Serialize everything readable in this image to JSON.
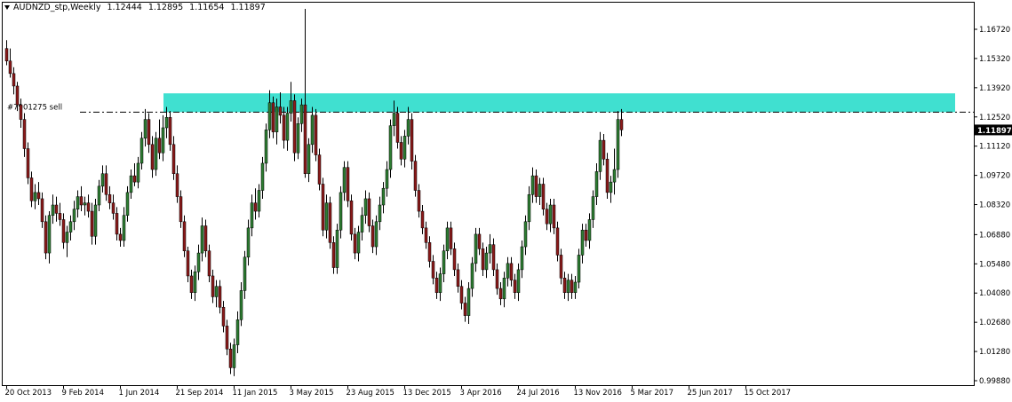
{
  "header": {
    "symbol": "AUDNZD_stp,Weekly",
    "open": "1.12444",
    "high": "1.12895",
    "low": "1.11654",
    "close": "1.11897"
  },
  "order_line": {
    "label": "#7901275 sell",
    "price": 1.1275
  },
  "zone": {
    "top": 1.1365,
    "bottom": 1.1275,
    "color": "#40E0D0"
  },
  "current_price": {
    "label": "1.11897",
    "value": 1.11897
  },
  "colors": {
    "bull": "#2E7D32",
    "bear": "#8B1A1A",
    "wick": "#000000",
    "grid": "#000000"
  },
  "chart_data": {
    "type": "candlestick",
    "ylim": [
      0.9988,
      1.1772
    ],
    "y_ticks": [
      "1.16720",
      "1.15320",
      "1.13920",
      "1.12520",
      "1.11120",
      "1.09720",
      "1.08320",
      "1.06880",
      "1.05480",
      "1.04080",
      "1.02680",
      "1.01280",
      "0.99880"
    ],
    "y_tick_values": [
      1.1672,
      1.1532,
      1.1392,
      1.1252,
      1.1112,
      1.0972,
      1.0832,
      1.0688,
      1.0548,
      1.0408,
      1.0268,
      1.0128,
      0.9988
    ],
    "x_ticks": [
      "20 Oct 2013",
      "9 Feb 2014",
      "1 Jun 2014",
      "21 Sep 2014",
      "11 Jan 2015",
      "3 May 2015",
      "23 Aug 2015",
      "13 Dec 2015",
      "3 Apr 2016",
      "24 Jul 2016",
      "13 Nov 2016",
      "5 Mar 2017",
      "25 Jun 2017",
      "15 Oct 2017"
    ],
    "x_tick_index": [
      0,
      16,
      32,
      48,
      64,
      80,
      96,
      112,
      128,
      144,
      160,
      176,
      192,
      208
    ],
    "candles": [
      [
        1.158,
        1.162,
        1.15,
        1.152
      ],
      [
        1.152,
        1.158,
        1.144,
        1.146
      ],
      [
        1.146,
        1.149,
        1.136,
        1.14
      ],
      [
        1.14,
        1.142,
        1.128,
        1.131
      ],
      [
        1.131,
        1.134,
        1.12,
        1.124
      ],
      [
        1.124,
        1.127,
        1.106,
        1.11
      ],
      [
        1.11,
        1.113,
        1.093,
        1.096
      ],
      [
        1.096,
        1.099,
        1.082,
        1.085
      ],
      [
        1.085,
        1.093,
        1.081,
        1.089
      ],
      [
        1.089,
        1.094,
        1.083,
        1.086
      ],
      [
        1.086,
        1.089,
        1.072,
        1.075
      ],
      [
        1.075,
        1.078,
        1.057,
        1.06
      ],
      [
        1.06,
        1.08,
        1.055,
        1.078
      ],
      [
        1.078,
        1.088,
        1.074,
        1.083
      ],
      [
        1.083,
        1.087,
        1.075,
        1.079
      ],
      [
        1.079,
        1.084,
        1.073,
        1.076
      ],
      [
        1.076,
        1.079,
        1.062,
        1.065
      ],
      [
        1.065,
        1.073,
        1.058,
        1.07
      ],
      [
        1.07,
        1.078,
        1.066,
        1.075
      ],
      [
        1.075,
        1.085,
        1.071,
        1.081
      ],
      [
        1.081,
        1.09,
        1.077,
        1.087
      ],
      [
        1.087,
        1.092,
        1.08,
        1.083
      ],
      [
        1.083,
        1.087,
        1.078,
        1.084
      ],
      [
        1.084,
        1.088,
        1.077,
        1.08
      ],
      [
        1.08,
        1.084,
        1.064,
        1.068
      ],
      [
        1.068,
        1.086,
        1.064,
        1.083
      ],
      [
        1.083,
        1.095,
        1.08,
        1.092
      ],
      [
        1.092,
        1.102,
        1.089,
        1.098
      ],
      [
        1.098,
        1.102,
        1.085,
        1.088
      ],
      [
        1.088,
        1.092,
        1.081,
        1.084
      ],
      [
        1.084,
        1.088,
        1.076,
        1.079
      ],
      [
        1.079,
        1.082,
        1.066,
        1.069
      ],
      [
        1.069,
        1.072,
        1.063,
        1.066
      ],
      [
        1.066,
        1.082,
        1.063,
        1.078
      ],
      [
        1.078,
        1.092,
        1.075,
        1.089
      ],
      [
        1.089,
        1.1,
        1.086,
        1.097
      ],
      [
        1.097,
        1.103,
        1.092,
        1.094
      ],
      [
        1.094,
        1.106,
        1.091,
        1.103
      ],
      [
        1.103,
        1.118,
        1.1,
        1.115
      ],
      [
        1.115,
        1.129,
        1.111,
        1.124
      ],
      [
        1.124,
        1.127,
        1.108,
        1.112
      ],
      [
        1.112,
        1.116,
        1.096,
        1.1
      ],
      [
        1.1,
        1.118,
        1.097,
        1.115
      ],
      [
        1.115,
        1.124,
        1.105,
        1.108
      ],
      [
        1.108,
        1.126,
        1.104,
        1.12
      ],
      [
        1.12,
        1.13,
        1.115,
        1.125
      ],
      [
        1.125,
        1.128,
        1.109,
        1.112
      ],
      [
        1.112,
        1.116,
        1.095,
        1.098
      ],
      [
        1.098,
        1.102,
        1.084,
        1.087
      ],
      [
        1.087,
        1.09,
        1.072,
        1.075
      ],
      [
        1.075,
        1.078,
        1.058,
        1.061
      ],
      [
        1.061,
        1.063,
        1.046,
        1.049
      ],
      [
        1.049,
        1.052,
        1.038,
        1.041
      ],
      [
        1.041,
        1.054,
        1.037,
        1.051
      ],
      [
        1.051,
        1.064,
        1.047,
        1.06
      ],
      [
        1.06,
        1.077,
        1.056,
        1.073
      ],
      [
        1.073,
        1.076,
        1.058,
        1.061
      ],
      [
        1.061,
        1.064,
        1.046,
        1.049
      ],
      [
        1.049,
        1.052,
        1.036,
        1.039
      ],
      [
        1.039,
        1.047,
        1.034,
        1.044
      ],
      [
        1.044,
        1.047,
        1.031,
        1.034
      ],
      [
        1.034,
        1.037,
        1.022,
        1.025
      ],
      [
        1.025,
        1.028,
        1.011,
        1.014
      ],
      [
        1.014,
        1.017,
        1.002,
        1.005
      ],
      [
        1.005,
        1.019,
        1.001,
        1.016
      ],
      [
        1.016,
        1.032,
        1.012,
        1.028
      ],
      [
        1.028,
        1.046,
        1.025,
        1.042
      ],
      [
        1.042,
        1.061,
        1.038,
        1.058
      ],
      [
        1.058,
        1.076,
        1.054,
        1.072
      ],
      [
        1.072,
        1.088,
        1.068,
        1.084
      ],
      [
        1.084,
        1.091,
        1.076,
        1.08
      ],
      [
        1.08,
        1.093,
        1.077,
        1.09
      ],
      [
        1.09,
        1.106,
        1.086,
        1.103
      ],
      [
        1.103,
        1.122,
        1.099,
        1.119
      ],
      [
        1.119,
        1.138,
        1.115,
        1.132
      ],
      [
        1.132,
        1.135,
        1.115,
        1.118
      ],
      [
        1.118,
        1.134,
        1.112,
        1.13
      ],
      [
        1.13,
        1.137,
        1.122,
        1.126
      ],
      [
        1.126,
        1.13,
        1.11,
        1.114
      ],
      [
        1.114,
        1.13,
        1.109,
        1.127
      ],
      [
        1.127,
        1.142,
        1.123,
        1.133
      ],
      [
        1.133,
        1.136,
        1.104,
        1.108
      ],
      [
        1.108,
        1.125,
        1.105,
        1.122
      ],
      [
        1.122,
        1.134,
        1.118,
        1.131
      ],
      [
        1.131,
        1.177,
        1.096,
        1.098
      ],
      [
        1.098,
        1.115,
        1.094,
        1.112
      ],
      [
        1.112,
        1.13,
        1.108,
        1.126
      ],
      [
        1.126,
        1.129,
        1.104,
        1.107
      ],
      [
        1.107,
        1.11,
        1.09,
        1.093
      ],
      [
        1.093,
        1.096,
        1.068,
        1.071
      ],
      [
        1.071,
        1.088,
        1.067,
        1.084
      ],
      [
        1.084,
        1.087,
        1.062,
        1.065
      ],
      [
        1.065,
        1.068,
        1.05,
        1.053
      ],
      [
        1.053,
        1.074,
        1.05,
        1.071
      ],
      [
        1.071,
        1.092,
        1.067,
        1.089
      ],
      [
        1.089,
        1.104,
        1.085,
        1.101
      ],
      [
        1.101,
        1.104,
        1.082,
        1.085
      ],
      [
        1.085,
        1.088,
        1.066,
        1.069
      ],
      [
        1.069,
        1.072,
        1.057,
        1.06
      ],
      [
        1.06,
        1.073,
        1.056,
        1.07
      ],
      [
        1.07,
        1.082,
        1.066,
        1.078
      ],
      [
        1.078,
        1.09,
        1.074,
        1.086
      ],
      [
        1.086,
        1.089,
        1.07,
        1.073
      ],
      [
        1.073,
        1.076,
        1.06,
        1.063
      ],
      [
        1.063,
        1.078,
        1.059,
        1.075
      ],
      [
        1.075,
        1.087,
        1.071,
        1.083
      ],
      [
        1.083,
        1.094,
        1.079,
        1.091
      ],
      [
        1.091,
        1.104,
        1.087,
        1.1
      ],
      [
        1.1,
        1.124,
        1.096,
        1.121
      ],
      [
        1.121,
        1.133,
        1.116,
        1.127
      ],
      [
        1.127,
        1.13,
        1.11,
        1.113
      ],
      [
        1.113,
        1.116,
        1.102,
        1.105
      ],
      [
        1.105,
        1.119,
        1.101,
        1.116
      ],
      [
        1.116,
        1.13,
        1.112,
        1.124
      ],
      [
        1.124,
        1.127,
        1.1,
        1.104
      ],
      [
        1.104,
        1.107,
        1.087,
        1.09
      ],
      [
        1.09,
        1.093,
        1.077,
        1.08
      ],
      [
        1.08,
        1.083,
        1.069,
        1.072
      ],
      [
        1.072,
        1.075,
        1.062,
        1.065
      ],
      [
        1.065,
        1.068,
        1.053,
        1.056
      ],
      [
        1.056,
        1.059,
        1.045,
        1.048
      ],
      [
        1.048,
        1.051,
        1.038,
        1.041
      ],
      [
        1.041,
        1.053,
        1.037,
        1.05
      ],
      [
        1.05,
        1.064,
        1.046,
        1.061
      ],
      [
        1.061,
        1.075,
        1.057,
        1.072
      ],
      [
        1.072,
        1.075,
        1.059,
        1.062
      ],
      [
        1.062,
        1.065,
        1.049,
        1.052
      ],
      [
        1.052,
        1.055,
        1.041,
        1.044
      ],
      [
        1.044,
        1.047,
        1.033,
        1.036
      ],
      [
        1.036,
        1.039,
        1.027,
        1.03
      ],
      [
        1.03,
        1.046,
        1.026,
        1.043
      ],
      [
        1.043,
        1.058,
        1.039,
        1.055
      ],
      [
        1.055,
        1.072,
        1.051,
        1.069
      ],
      [
        1.069,
        1.072,
        1.059,
        1.062
      ],
      [
        1.062,
        1.065,
        1.049,
        1.052
      ],
      [
        1.052,
        1.063,
        1.048,
        1.06
      ],
      [
        1.06,
        1.069,
        1.055,
        1.064
      ],
      [
        1.064,
        1.067,
        1.049,
        1.052
      ],
      [
        1.052,
        1.055,
        1.04,
        1.043
      ],
      [
        1.043,
        1.046,
        1.035,
        1.038
      ],
      [
        1.038,
        1.051,
        1.034,
        1.048
      ],
      [
        1.048,
        1.058,
        1.044,
        1.055
      ],
      [
        1.055,
        1.058,
        1.044,
        1.047
      ],
      [
        1.047,
        1.05,
        1.038,
        1.041
      ],
      [
        1.041,
        1.055,
        1.037,
        1.052
      ],
      [
        1.052,
        1.066,
        1.048,
        1.063
      ],
      [
        1.063,
        1.078,
        1.059,
        1.075
      ],
      [
        1.075,
        1.092,
        1.071,
        1.088
      ],
      [
        1.088,
        1.101,
        1.084,
        1.097
      ],
      [
        1.097,
        1.1,
        1.084,
        1.087
      ],
      [
        1.087,
        1.096,
        1.083,
        1.093
      ],
      [
        1.093,
        1.096,
        1.078,
        1.081
      ],
      [
        1.081,
        1.084,
        1.071,
        1.074
      ],
      [
        1.074,
        1.086,
        1.07,
        1.083
      ],
      [
        1.083,
        1.086,
        1.069,
        1.072
      ],
      [
        1.072,
        1.075,
        1.056,
        1.059
      ],
      [
        1.059,
        1.062,
        1.045,
        1.048
      ],
      [
        1.048,
        1.051,
        1.038,
        1.041
      ],
      [
        1.041,
        1.05,
        1.037,
        1.047
      ],
      [
        1.047,
        1.05,
        1.038,
        1.041
      ],
      [
        1.041,
        1.049,
        1.038,
        1.046
      ],
      [
        1.046,
        1.062,
        1.043,
        1.059
      ],
      [
        1.059,
        1.074,
        1.055,
        1.071
      ],
      [
        1.071,
        1.074,
        1.063,
        1.066
      ],
      [
        1.066,
        1.079,
        1.062,
        1.076
      ],
      [
        1.076,
        1.09,
        1.072,
        1.087
      ],
      [
        1.087,
        1.103,
        1.083,
        1.099
      ],
      [
        1.099,
        1.118,
        1.095,
        1.114
      ],
      [
        1.114,
        1.117,
        1.102,
        1.105
      ],
      [
        1.105,
        1.108,
        1.086,
        1.089
      ],
      [
        1.089,
        1.097,
        1.084,
        1.094
      ],
      [
        1.094,
        1.11,
        1.088,
        1.1
      ],
      [
        1.1,
        1.128,
        1.096,
        1.124
      ],
      [
        1.124,
        1.129,
        1.116,
        1.119
      ]
    ]
  }
}
